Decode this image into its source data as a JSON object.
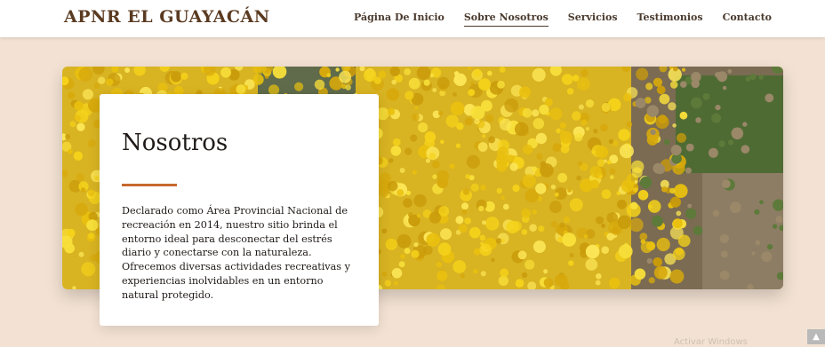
{
  "brand": "APNR EL GUAYACÁN",
  "nav": [
    {
      "label": "Página De Inicio"
    },
    {
      "label": "Sobre Nosotros",
      "active": true
    },
    {
      "label": "Servicios"
    },
    {
      "label": "Testimonios"
    },
    {
      "label": "Contacto"
    }
  ],
  "about": {
    "title": "Nosotros",
    "body": "Declarado como Área Provincial Nacional de recreación en 2014, nuestro sitio brinda el entorno ideal para desconectar del estrés diario y conectarse con la naturaleza. Ofrecemos diversas actividades recreativas y experiencias inolvidables en un entorno natural protegido."
  },
  "watermark": "Activar Windows",
  "colors": {
    "page_bg": "#f3e2d3",
    "brand": "#5a3b22",
    "accent": "#c8692e",
    "blossom": "#f2cf16"
  },
  "icons": {
    "scroll_top": "chevron-up-icon"
  }
}
